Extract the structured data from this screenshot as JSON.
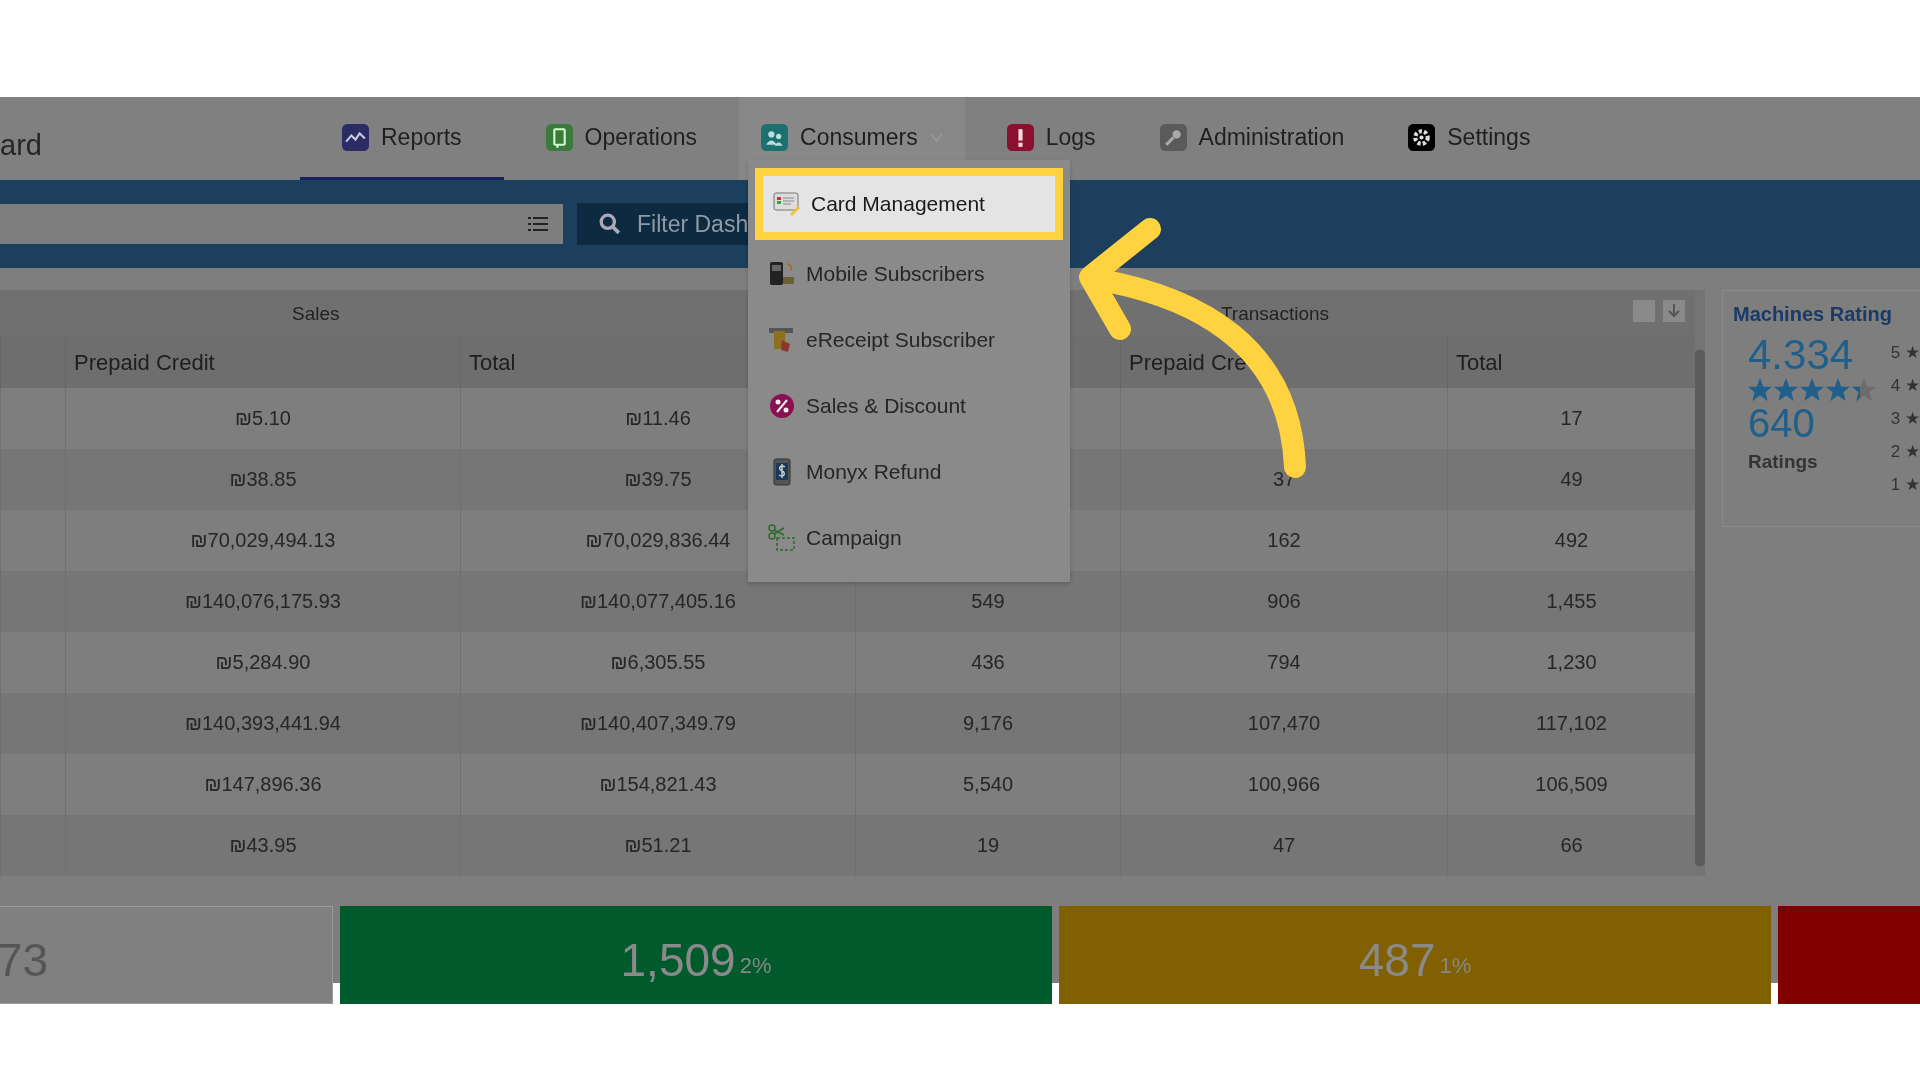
{
  "header": {
    "title": "ard"
  },
  "tabs": [
    {
      "label": "Reports",
      "selected": true,
      "expanded": false
    },
    {
      "label": "Operations",
      "selected": false,
      "expanded": false
    },
    {
      "label": "Consumers",
      "selected": false,
      "expanded": true
    },
    {
      "label": "Logs",
      "selected": false,
      "expanded": false
    },
    {
      "label": "Administration",
      "selected": false,
      "expanded": false
    },
    {
      "label": "Settings",
      "selected": false,
      "expanded": false
    }
  ],
  "filter_bar": {
    "button": "Filter Dash"
  },
  "consumers_menu": [
    {
      "label": "Card Management",
      "selected": true
    },
    {
      "label": "Mobile Subscribers",
      "selected": false
    },
    {
      "label": "eReceipt Subscriber",
      "selected": false
    },
    {
      "label": "Sales & Discount",
      "selected": false
    },
    {
      "label": "Monyx Refund",
      "selected": false
    },
    {
      "label": "Campaign",
      "selected": false
    }
  ],
  "table": {
    "groups": [
      "Sales",
      "Transactions"
    ],
    "columns": [
      "Prepaid Credit",
      "Total",
      "Prepaid Cre",
      "Total"
    ],
    "rows": [
      {
        "sales_prepaid_credit": "₪5.10",
        "sales_total": "₪11.46",
        "transactions_total": "17"
      },
      {
        "sales_prepaid_credit": "₪38.85",
        "sales_total": "₪39.75",
        "transactions_prepaid_credit": "37",
        "transactions_total": "49"
      },
      {
        "sales_prepaid_credit": "₪70,029,494.13",
        "sales_total": "₪70,029,836.44",
        "transactions_prepaid_credit": "162",
        "transactions_total": "492"
      },
      {
        "sales_prepaid_credit": "₪140,076,175.93",
        "sales_total": "₪140,077,405.16",
        "column_3": "549",
        "transactions_prepaid_credit": "906",
        "transactions_total": "1,455"
      },
      {
        "sales_prepaid_credit": "₪5,284.90",
        "sales_total": "₪6,305.55",
        "column_3": "436",
        "transactions_prepaid_credit": "794",
        "transactions_total": "1,230"
      },
      {
        "sales_prepaid_credit": "₪140,393,441.94",
        "sales_total": "₪140,407,349.79",
        "column_3": "9,176",
        "transactions_prepaid_credit": "107,470",
        "transactions_total": "117,102"
      },
      {
        "sales_prepaid_credit": "₪147,896.36",
        "sales_total": "₪154,821.43",
        "column_3": "5,540",
        "transactions_prepaid_credit": "100,966",
        "transactions_total": "106,509"
      },
      {
        "sales_prepaid_credit": "₪43.95",
        "sales_total": "₪51.21",
        "column_3": "19",
        "transactions_prepaid_credit": "47",
        "transactions_total": "66"
      }
    ]
  },
  "machines_rating": {
    "title": "Machines Rating",
    "score": "4.334",
    "stars": 4.334,
    "count": "640",
    "count_label": "Ratings",
    "distribution": [
      "5 ★",
      "4 ★",
      "3 ★",
      "2 ★",
      "1 ★"
    ]
  },
  "tiles": [
    {
      "value": "73",
      "color": "#808080"
    },
    {
      "value": "1,509",
      "percent": "2%",
      "color": "#005a2b"
    },
    {
      "value": "487",
      "percent": "1%",
      "color": "#806000"
    },
    {
      "color": "#800000"
    }
  ]
}
